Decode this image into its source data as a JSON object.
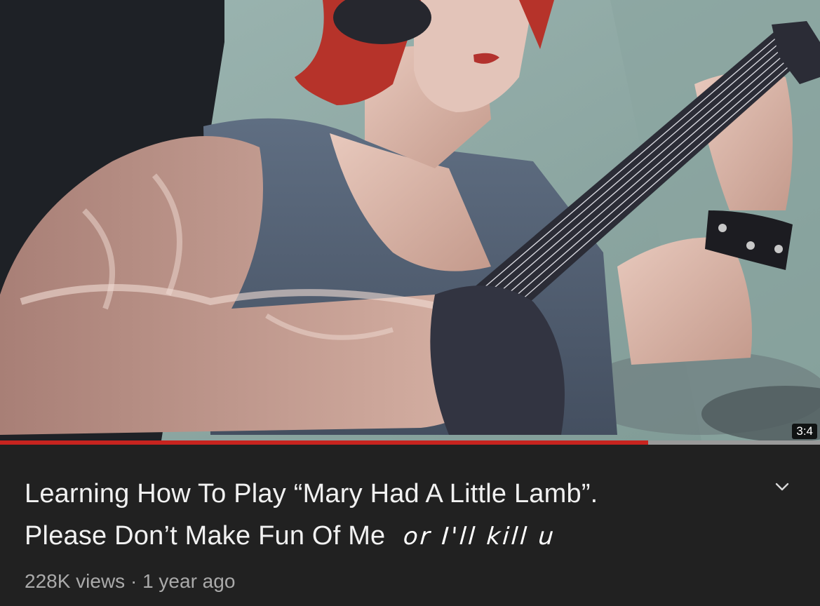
{
  "video": {
    "duration": "3:4",
    "progress_fraction": 0.79,
    "colors": {
      "progress": "#c7241f",
      "track": "#9a9a9a",
      "background": "#212121"
    }
  },
  "info": {
    "title_line1": "Learning How To Play “Mary Had A Little Lamb”.",
    "title_line2": "Please Don’t Make Fun Of Me",
    "handwritten_note": "or I'll kill u",
    "views": "228K views",
    "separator": "·",
    "age": "1 year ago",
    "expand_icon": "chevron-down-icon"
  }
}
